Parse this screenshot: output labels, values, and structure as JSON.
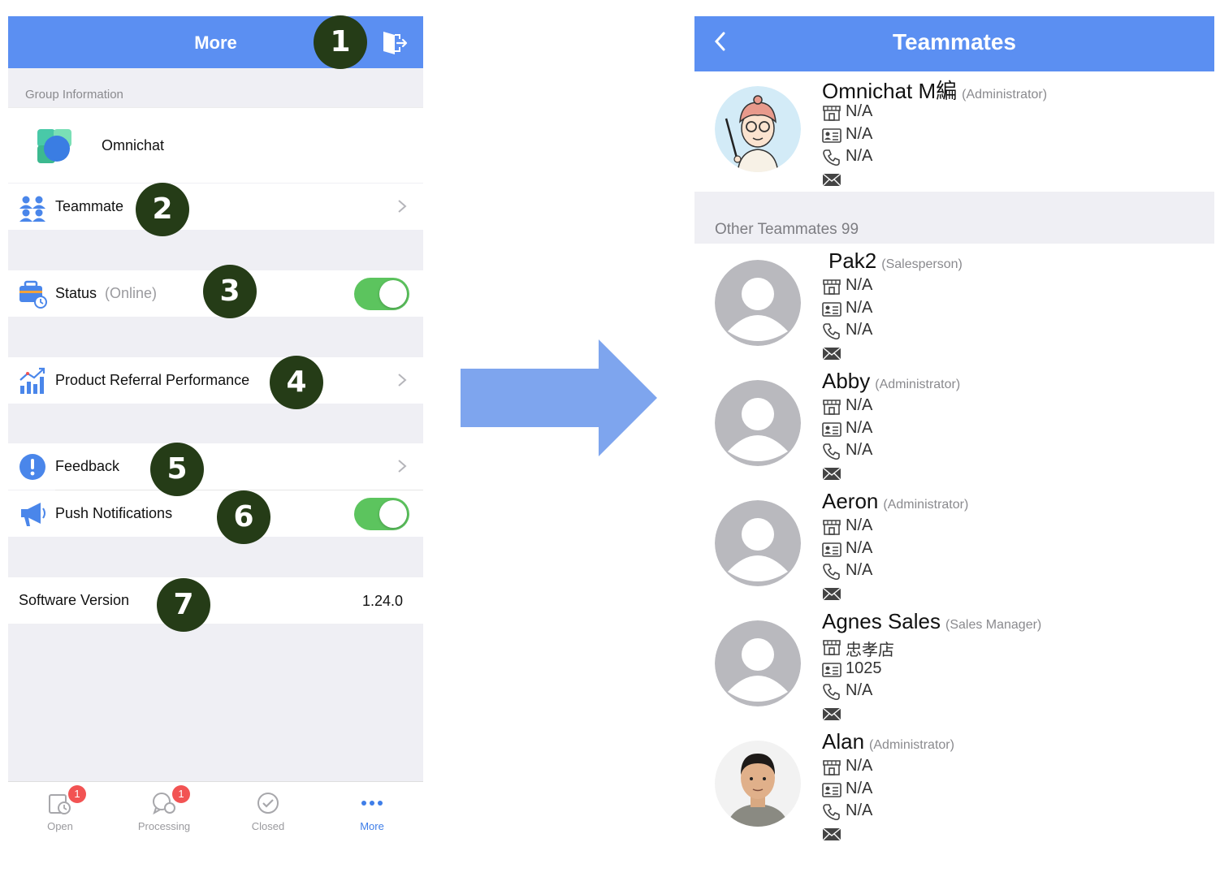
{
  "left": {
    "header_title": "More",
    "section_label": "Group Information",
    "group_name": "Omnichat",
    "teammate_label": "Teammate",
    "status_label": "Status",
    "status_value": "(Online)",
    "referral_label": "Product Referral Performance",
    "feedback_label": "Feedback",
    "push_label": "Push Notifications",
    "version_label": "Software Version",
    "version_value": "1.24.0",
    "tabs": [
      {
        "label": "Open",
        "badge": "1"
      },
      {
        "label": "Processing",
        "badge": "1"
      },
      {
        "label": "Closed"
      },
      {
        "label": "More"
      }
    ],
    "markers": [
      "1",
      "2",
      "3",
      "4",
      "5",
      "6",
      "7"
    ]
  },
  "right": {
    "header_title": "Teammates",
    "others_label": "Other Teammates 99",
    "members": [
      {
        "name": "Omnichat M編",
        "role": "(Administrator)",
        "store": "N/A",
        "id": "N/A",
        "phone": "N/A"
      },
      {
        "name": "Pak2",
        "role": "(Salesperson)",
        "store": "N/A",
        "id": "N/A",
        "phone": "N/A"
      },
      {
        "name": "Abby",
        "role": "(Administrator)",
        "store": "N/A",
        "id": "N/A",
        "phone": "N/A"
      },
      {
        "name": "Aeron",
        "role": "(Administrator)",
        "store": "N/A",
        "id": "N/A",
        "phone": "N/A"
      },
      {
        "name": "Agnes Sales",
        "role": "(Sales Manager)",
        "store": "忠孝店",
        "id": "1025",
        "phone": "N/A"
      },
      {
        "name": "Alan",
        "role": "(Administrator)",
        "store": "N/A",
        "id": "N/A",
        "phone": "N/A"
      }
    ]
  },
  "colors": {
    "header_blue": "#5b8ff2",
    "toggle_green": "#5cc45e",
    "marker_green": "#253c17",
    "badge_red": "#f25353",
    "active_tab_blue": "#3f7ee8",
    "arrow_blue": "#7ea5ee"
  },
  "icons": [
    "logout-icon",
    "omnichat-logo",
    "teammate-icon",
    "status-briefcase-icon",
    "chart-icon",
    "feedback-icon",
    "megaphone-icon",
    "chevron-right-icon",
    "back-chevron-icon",
    "store-icon",
    "id-card-icon",
    "phone-icon",
    "mail-icon",
    "user-placeholder-icon"
  ]
}
